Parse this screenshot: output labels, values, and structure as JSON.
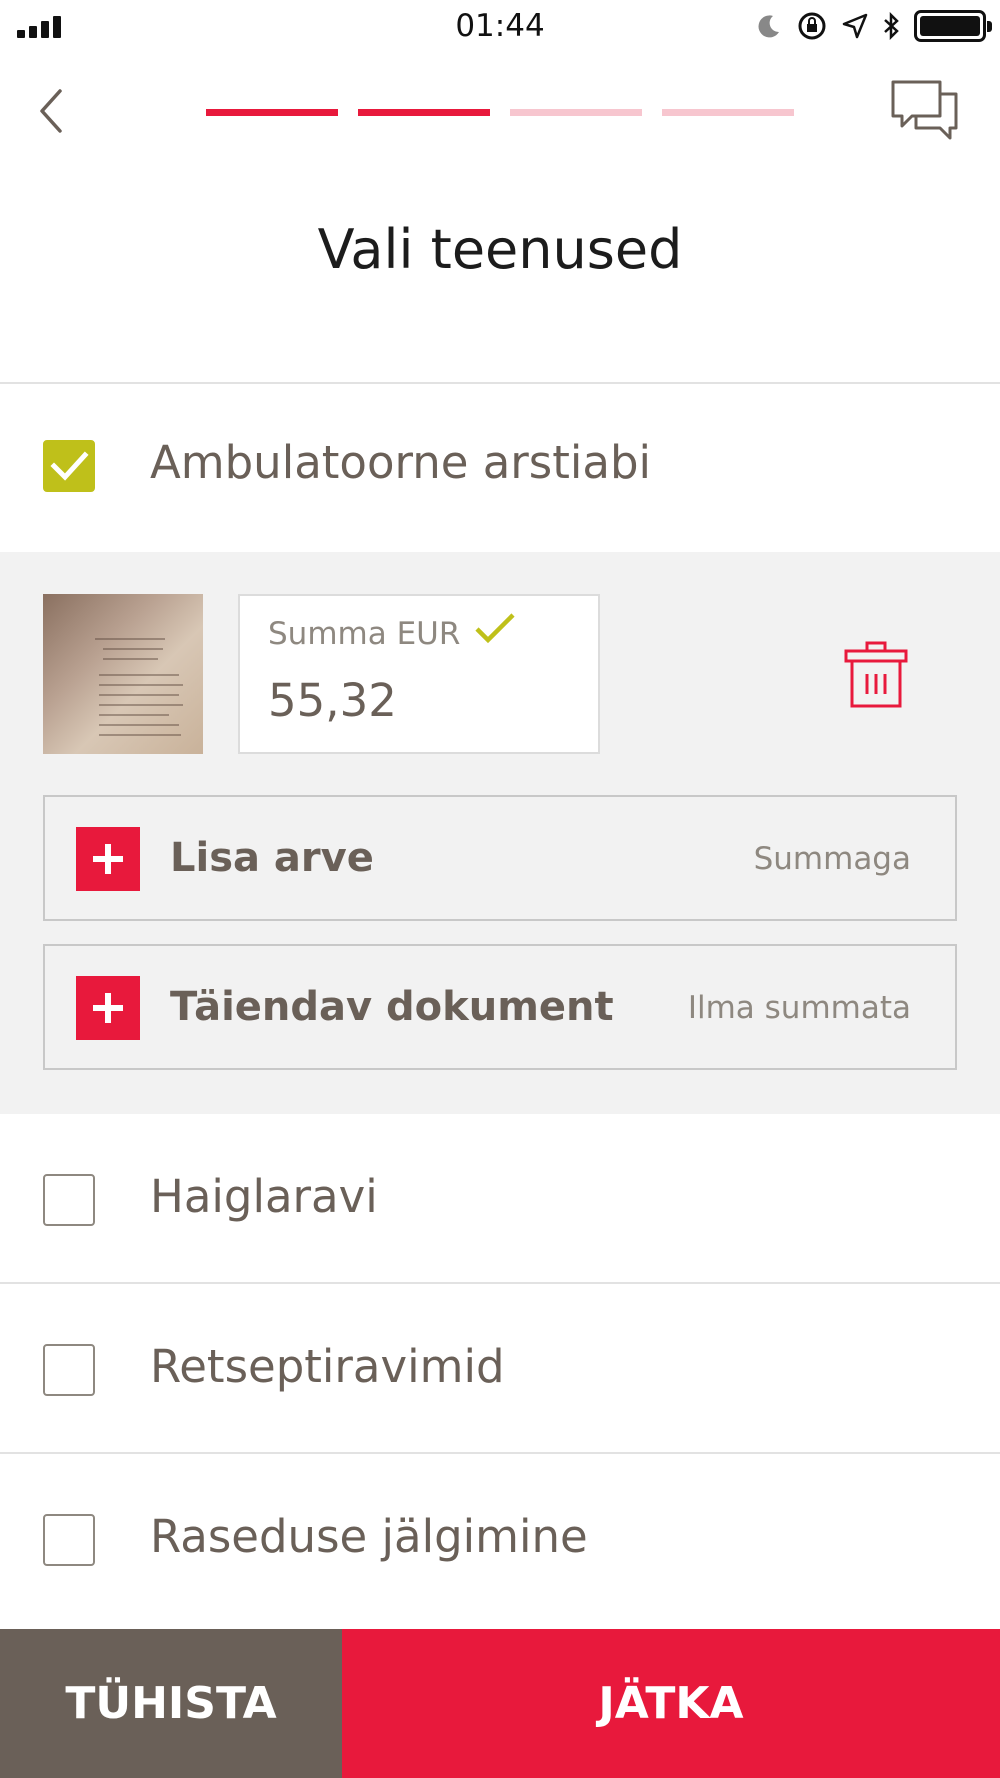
{
  "status_bar": {
    "time": "01:44",
    "icons": [
      "signal-icon",
      "moon-icon",
      "orientation-lock-icon",
      "location-icon",
      "bluetooth-icon",
      "battery-icon"
    ]
  },
  "nav": {
    "back_icon": "chevron-left-icon",
    "chat_icon": "chat-bubbles-icon",
    "progress_steps": 4,
    "progress_completed": 2
  },
  "page": {
    "title": "Vali teenused"
  },
  "services": [
    {
      "label": "Ambulatoorne arstiabi",
      "checked": true
    },
    {
      "label": "Haiglaravi",
      "checked": false
    },
    {
      "label": "Retseptiravimid",
      "checked": false
    },
    {
      "label": "Raseduse jälgimine",
      "checked": false
    }
  ],
  "invoice": {
    "amount_label": "Summa EUR",
    "amount_value": "55,32",
    "delete_icon": "trash-icon"
  },
  "add_actions": [
    {
      "label": "Lisa arve",
      "hint": "Summaga"
    },
    {
      "label": "Täiendav dokument",
      "hint": "Ilma summata"
    }
  ],
  "footer": {
    "cancel_label": "TÜHISTA",
    "continue_label": "JÄTKA"
  },
  "colors": {
    "accent": "#e8193c",
    "accent_light": "#f7c6cf",
    "check": "#bfc01a",
    "text": "#6a6058",
    "panel": "#f2f2f2"
  }
}
